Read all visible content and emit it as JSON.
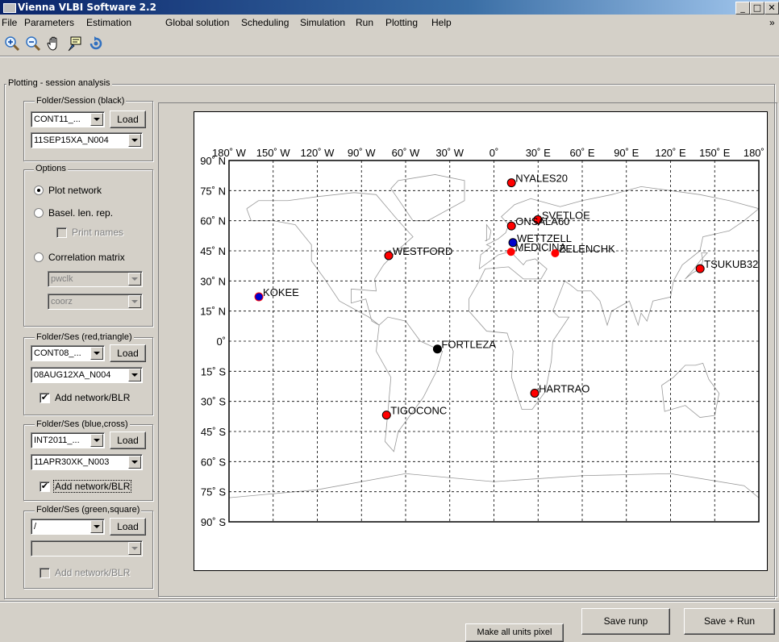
{
  "window": {
    "title": "Vienna VLBI Software 2.2",
    "minimize": "_",
    "maximize": "□",
    "close": "✕"
  },
  "menu": [
    "File",
    "Parameters",
    "Estimation",
    "Global solution",
    "Scheduling",
    "Simulation",
    "Run",
    "Plotting",
    "Help"
  ],
  "toolbar": {
    "icons": [
      "zoom-in-icon",
      "zoom-out-icon",
      "pan-hand-icon",
      "data-cursor-icon",
      "rotate-3d-icon"
    ],
    "chevron": "»"
  },
  "panel_title": "Plotting - session analysis",
  "folder_black": {
    "label": "Folder/Session (black)",
    "folder": "CONT11_...",
    "session": "11SEP15XA_N004",
    "load": "Load"
  },
  "options": {
    "label": "Options",
    "plot_network": "Plot network",
    "basel_len_rep": "Basel. len. rep.",
    "print_names": "Print names",
    "correlation_matrix": "Correlation matrix",
    "param1": "pwclk",
    "param2": "coorz",
    "selected": "Plot network"
  },
  "folder_red": {
    "label": "Folder/Ses (red,triangle)",
    "folder": "CONT08_...",
    "session": "08AUG12XA_N004",
    "load": "Load",
    "add_network": "Add network/BLR",
    "checked": true
  },
  "folder_blue": {
    "label": "Folder/Ses (blue,cross)",
    "folder": "INT2011_...",
    "session": "11APR30XK_N003",
    "load": "Load",
    "add_network": "Add network/BLR",
    "checked": true
  },
  "folder_green": {
    "label": "Folder/Ses (green,square)",
    "folder": "/",
    "session": "",
    "load": "Load",
    "add_network": "Add network/BLR",
    "checked": false
  },
  "buttons": {
    "save_runp": "Save runp",
    "save_run": "Save + Run",
    "make_pixel": "Make all units pixel"
  },
  "map": {
    "lon_ticks": [
      "180˚ W",
      "150˚ W",
      "120˚ W",
      "90˚ W",
      "60˚ W",
      "30˚ W",
      "0˚",
      "30˚ E",
      "60˚ E",
      "90˚ E",
      "120˚ E",
      "150˚ E",
      "180˚ E"
    ],
    "lat_ticks": [
      "90˚ N",
      "75˚ N",
      "60˚ N",
      "45˚ N",
      "30˚ N",
      "15˚ N",
      "0˚",
      "15˚ S",
      "30˚ S",
      "45˚ S",
      "60˚ S",
      "75˚ S",
      "90˚ S"
    ],
    "stations": [
      {
        "name": "NYALES20",
        "lon": 11.9,
        "lat": 78.9,
        "color": "#ff0000",
        "outline": "#000"
      },
      {
        "name": "SVETLOE",
        "lon": 29.8,
        "lat": 60.5,
        "color": "#ff0000",
        "outline": "#000"
      },
      {
        "name": "ONSALA60",
        "lon": 11.9,
        "lat": 57.4,
        "color": "#ff0000",
        "outline": "#000"
      },
      {
        "name": "WETTZELL",
        "lon": 12.9,
        "lat": 49.1,
        "color": "#0000cc",
        "outline": "#000"
      },
      {
        "name": "MEDICINA",
        "lon": 11.6,
        "lat": 44.5,
        "color": "#ff0000",
        "outline": "none"
      },
      {
        "name": "ZELENCHK",
        "lon": 41.6,
        "lat": 43.8,
        "color": "#ff0000",
        "outline": "none"
      },
      {
        "name": "WESTFORD",
        "lon": -71.5,
        "lat": 42.6,
        "color": "#ff0000",
        "outline": "#000"
      },
      {
        "name": "TSUKUB32",
        "lon": 140.1,
        "lat": 36.1,
        "color": "#ff0000",
        "outline": "#000"
      },
      {
        "name": "KOKEE",
        "lon": -159.7,
        "lat": 22.1,
        "color": "#0000cc",
        "outline": "#ff0000"
      },
      {
        "name": "FORTLEZA",
        "lon": -38.4,
        "lat": -3.9,
        "color": "#000000",
        "outline": "#000"
      },
      {
        "name": "HARTRAO",
        "lon": 27.7,
        "lat": -25.9,
        "color": "#ff0000",
        "outline": "#000"
      },
      {
        "name": "TIGOCONC",
        "lon": -73.0,
        "lat": -36.8,
        "color": "#ff0000",
        "outline": "#000"
      }
    ]
  }
}
